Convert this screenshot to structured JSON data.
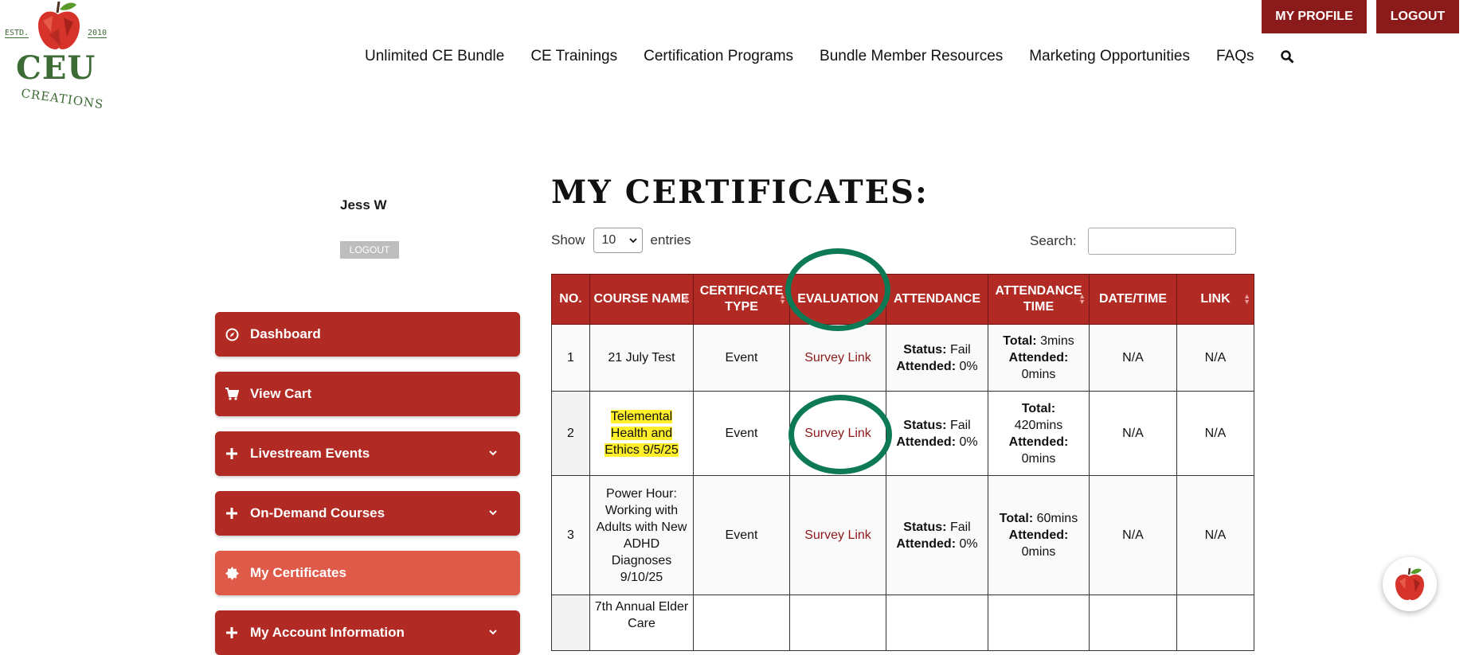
{
  "header": {
    "logo": {
      "estd": "ESTD.",
      "year": "2010",
      "ceu": "CEU",
      "creations": "CREATIONS"
    },
    "top_buttons": {
      "profile": "MY PROFILE",
      "logout": "LOGOUT"
    },
    "nav": [
      "Unlimited CE Bundle",
      "CE Trainings",
      "Certification Programs",
      "Bundle Member Resources",
      "Marketing Opportunities",
      "FAQs"
    ],
    "search_icon": "search-icon"
  },
  "sidebar": {
    "user_name": "Jess W",
    "logout": "LOGOUT",
    "items": [
      {
        "label": "Dashboard",
        "icon": "compass-icon"
      },
      {
        "label": "View Cart",
        "icon": "cart-icon"
      },
      {
        "label": "Livestream Events",
        "icon": "plus-icon"
      },
      {
        "label": "On-Demand Courses",
        "icon": "plus-icon"
      },
      {
        "label": "My Certificates",
        "icon": "badge-icon"
      },
      {
        "label": "My Account Information",
        "icon": "plus-icon"
      }
    ]
  },
  "main": {
    "title": "MY CERTIFICATES:",
    "show_label": "Show",
    "page_length": "10",
    "entries_label": "entries",
    "search_label": "Search:",
    "columns": [
      "NO.",
      "COURSE NAME",
      "CERTIFICATE TYPE",
      "EVALUATION",
      "ATTENDANCE",
      "ATTENDANCE TIME",
      "DATE/TIME",
      "LINK"
    ],
    "rows": [
      {
        "no": "1",
        "course": "21 July Test",
        "type": "Event",
        "evaluation": "Survey Link",
        "status_label": "Status:",
        "status": "Fail",
        "attended_label": "Attended:",
        "attended": "0%",
        "total_label": "Total:",
        "total": "3mins",
        "att_time_label": "Attended:",
        "att_time": "0mins",
        "date": "N/A",
        "link": "N/A"
      },
      {
        "no": "2",
        "course": "Telemental Health and Ethics 9/5/25",
        "type": "Event",
        "evaluation": "Survey Link",
        "status_label": "Status:",
        "status": "Fail",
        "attended_label": "Attended:",
        "attended": "0%",
        "total_label": "Total:",
        "total": "420mins",
        "att_time_label": "Attended:",
        "att_time": "0mins",
        "date": "N/A",
        "link": "N/A"
      },
      {
        "no": "3",
        "course": "Power Hour: Working with Adults with New ADHD Diagnoses 9/10/25",
        "type": "Event",
        "evaluation": "Survey Link",
        "status_label": "Status:",
        "status": "Fail",
        "attended_label": "Attended:",
        "attended": "0%",
        "total_label": "Total:",
        "total": "60mins",
        "att_time_label": "Attended:",
        "att_time": "0mins",
        "date": "N/A",
        "link": "N/A"
      },
      {
        "no": "",
        "course": "7th Annual Elder Care",
        "type": "",
        "evaluation": "",
        "date": "",
        "link": ""
      }
    ]
  },
  "colors": {
    "brand_red": "#b12a23",
    "dark_red": "#8b1a1a",
    "active_red": "#e05a4a",
    "green": "#3d6b35",
    "annotation_green": "#0d7a55",
    "highlight": "#ffef2b"
  },
  "chat_icon": "apple-chat-icon"
}
